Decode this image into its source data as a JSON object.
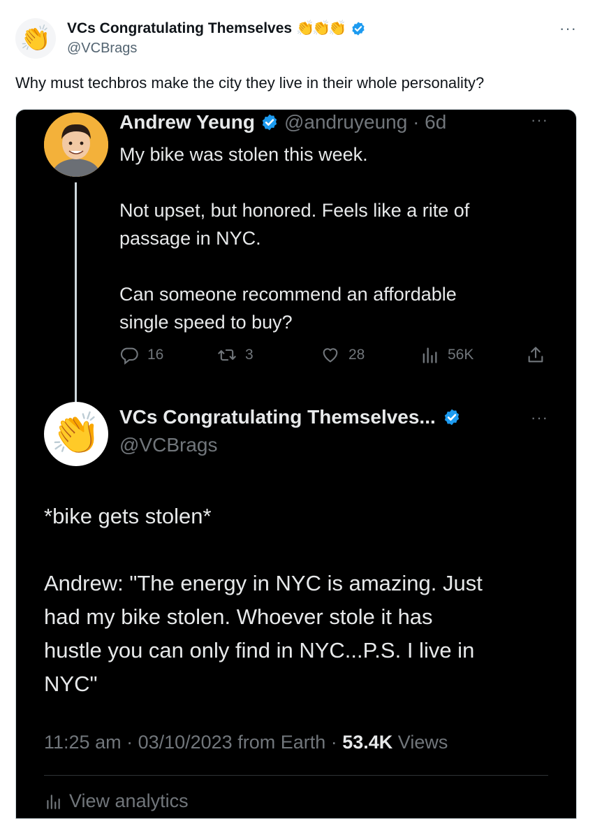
{
  "outer": {
    "avatar_icon": "clapping-hands-icon",
    "display_name": "VCs Congratulating Themselves",
    "name_emojis": "👏👏👏",
    "handle": "@VCBrags",
    "more": "···",
    "text": "Why must techbros make the city they live in their whole personality?"
  },
  "tweet1": {
    "name": "Andrew Yeung",
    "handle_time": "@andruyeung · 6d",
    "more": "···",
    "lines": [
      "My bike was stolen this week.",
      "",
      "Not upset, but honored. Feels like a rite of",
      "passage in NYC.",
      "",
      "Can someone recommend an affordable",
      "single speed to buy?"
    ],
    "replies": "16",
    "retweets": "3",
    "likes": "28",
    "views": "56K"
  },
  "tweet2": {
    "avatar_icon": "clapping-hands-icon",
    "name": "VCs Congratulating Themselves...",
    "handle": "@VCBrags",
    "more": "···",
    "body_line1": "*bike gets stolen*",
    "body_lines2": [
      "Andrew: \"The energy in NYC is amazing. Just",
      "had my bike stolen. Whoever stole it has",
      "hustle you can only find in NYC...P.S. I live in",
      "NYC\""
    ],
    "meta_time": "11:25 am · 03/10/2023 from Earth · ",
    "meta_views_count": "53.4K",
    "meta_views_label": " Views",
    "analytics": "View analytics"
  },
  "colors": {
    "verified": "#1d9bf0",
    "card_bg": "#000000"
  }
}
